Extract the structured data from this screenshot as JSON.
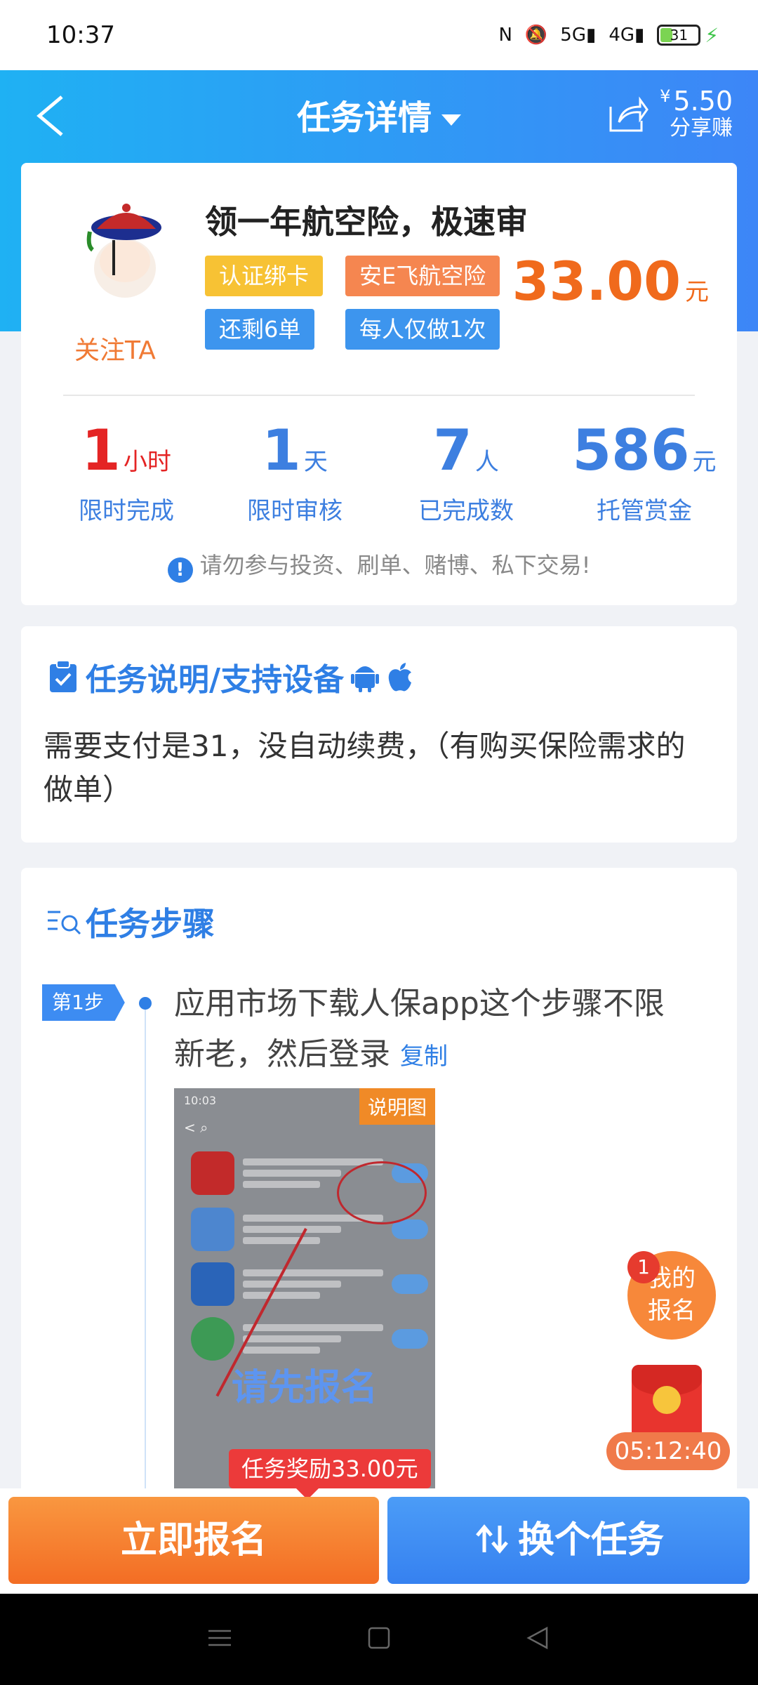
{
  "status_bar": {
    "time": "10:37",
    "network1": "5G",
    "network2": "4G",
    "battery": "31"
  },
  "header": {
    "title": "任务详情",
    "share_currency": "¥",
    "share_amount": "5.50",
    "share_label": "分享赚"
  },
  "task": {
    "title": "领一年航空险，极速审",
    "follow_label": "关注TA",
    "tags": [
      "认证绑卡",
      "安E飞航空险",
      "还剩6单",
      "每人仅做1次"
    ],
    "reward_amount": "33.00",
    "reward_unit": "元",
    "stats": [
      {
        "value": "1",
        "unit": "小时",
        "label": "限时完成"
      },
      {
        "value": "1",
        "unit": "天",
        "label": "限时审核"
      },
      {
        "value": "7",
        "unit": "人",
        "label": "已完成数"
      },
      {
        "value": "586",
        "unit": "元",
        "label": "托管赏金"
      }
    ],
    "warning": "请勿参与投资、刷单、赌博、私下交易!"
  },
  "description": {
    "title": "任务说明/支持设备",
    "text": "需要支付是31，没自动续费，（有购买保险需求的做单）"
  },
  "steps": {
    "title": "任务步骤",
    "items": [
      {
        "badge": "第1步",
        "text": "应用市场下载人保app这个步骤不限新老，然后登录",
        "copy_label": "复制",
        "image_label": "说明图",
        "overlay_text": "请先报名"
      }
    ]
  },
  "floating": {
    "signup_badge": "1",
    "signup_label": "我的报名",
    "timer": "05:12:40"
  },
  "bottom": {
    "tip": "任务奖励33.00元",
    "signup_button": "立即报名",
    "switch_button": "换个任务"
  },
  "colors": {
    "header_start": "#1fb1f3",
    "header_end": "#3d86f7",
    "accent_blue": "#2f7fe5",
    "accent_orange": "#f06a1c"
  }
}
